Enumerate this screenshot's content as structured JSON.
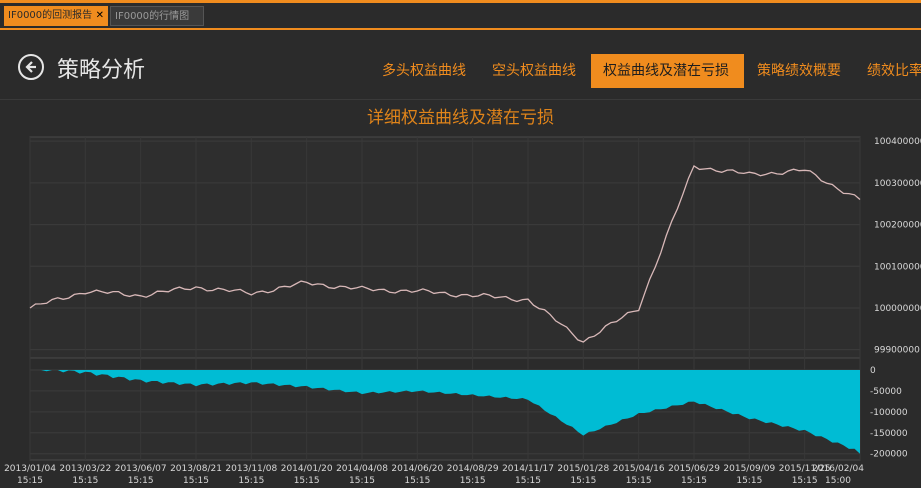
{
  "tabs": [
    {
      "label": "IF0000的回测报告",
      "close": "✕"
    },
    {
      "label": "IF0000的行情图"
    }
  ],
  "header": {
    "title": "策略分析"
  },
  "nav": [
    "多头权益曲线",
    "空头权益曲线",
    "权益曲线及潜在亏损",
    "策略绩效概要",
    "绩效比率"
  ],
  "chart_data": {
    "type": "line",
    "title": "详细权益曲线及潜在亏损",
    "x": [
      "2013/01/04 15:15",
      "2013/03/22 15:15",
      "2013/06/07 15:15",
      "2013/08/21 15:15",
      "2013/11/08 15:15",
      "2014/01/20 15:15",
      "2014/04/08 15:15",
      "2014/06/20 15:15",
      "2014/08/29 15:15",
      "2014/11/17 15:15",
      "2015/01/28 15:15",
      "2015/04/16 15:15",
      "2015/06/29 15:15",
      "2015/09/09 15:15",
      "2015/11/25 15:15",
      "2016/02/04 15:00"
    ],
    "series": [
      {
        "values": [
          100000000,
          100040000,
          100030000,
          100050000,
          100035000,
          100060000,
          100045000,
          100040000,
          100030000,
          100020000,
          99920000,
          100000000,
          100340000,
          100320000,
          100330000,
          100260000
        ]
      },
      {
        "values": [
          0,
          -10000,
          -30000,
          -40000,
          -35000,
          -45000,
          -60000,
          -55000,
          -65000,
          -75000,
          -160000,
          -110000,
          -80000,
          -120000,
          -150000,
          -200000
        ]
      }
    ],
    "colors": {
      "equity": "#d8b8b8",
      "drawdown": "#00bcd4"
    },
    "ylim_equity": [
      99880000,
      100410000
    ],
    "yticks_equity": [
      "100400000",
      "100300000",
      "100200000",
      "100100000",
      "100000000",
      "99900000"
    ],
    "ylim_drawdown": [
      -215000,
      0
    ],
    "yticks_drawdown": [
      "0",
      "-50000",
      "-100000",
      "-150000",
      "-200000"
    ]
  }
}
